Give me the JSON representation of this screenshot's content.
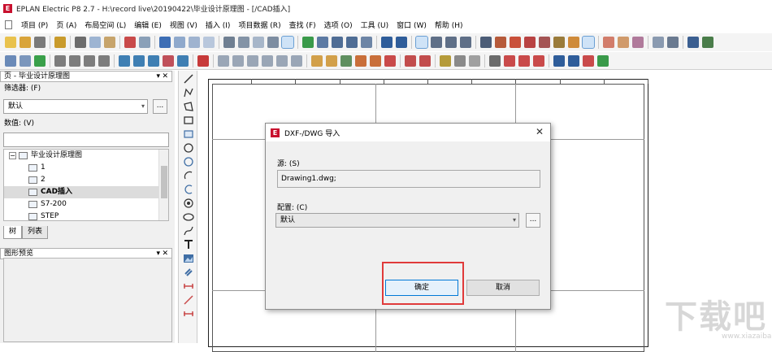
{
  "window": {
    "title": "EPLAN Electric P8 2.7 - H:\\record live\\20190422\\毕业设计原理图 - [/CAD插入]",
    "app_icon": "eplan-logo-icon"
  },
  "menu": [
    "项目 (P)",
    "页 (A)",
    "布局空间 (L)",
    "编辑 (E)",
    "视图 (V)",
    "插入 (I)",
    "项目数据 (R)",
    "查找 (F)",
    "选项 (O)",
    "工具 (U)",
    "窗口 (W)",
    "帮助 (H)"
  ],
  "left_panel": {
    "pages_header": "页 - 毕业设计原理图",
    "filter_label": "筛选器: (F)",
    "filter_value": "默认",
    "value_label": "数值: (V)",
    "value_field": "",
    "tree": {
      "root": "毕业设计原理图",
      "items": [
        "1",
        "2",
        "CAD插入",
        "S7-200",
        "STEP"
      ],
      "selected": "CAD插入"
    },
    "tabs": [
      "树",
      "列表"
    ],
    "preview_header": "图形预览"
  },
  "dialog": {
    "title": "DXF-/DWG 导入",
    "source_label": "源: (S)",
    "source_value": "Drawing1.dwg;",
    "config_label": "配置: (C)",
    "config_value": "默认",
    "ok_label": "确定",
    "cancel_label": "取消",
    "close_glyph": "✕",
    "highlight_color": "#e03a3a"
  },
  "watermark": {
    "text": "下载吧",
    "small": "www.xiazaiba.com"
  },
  "colors": {
    "accent": "#0078d7",
    "brand": "#c8102e"
  }
}
